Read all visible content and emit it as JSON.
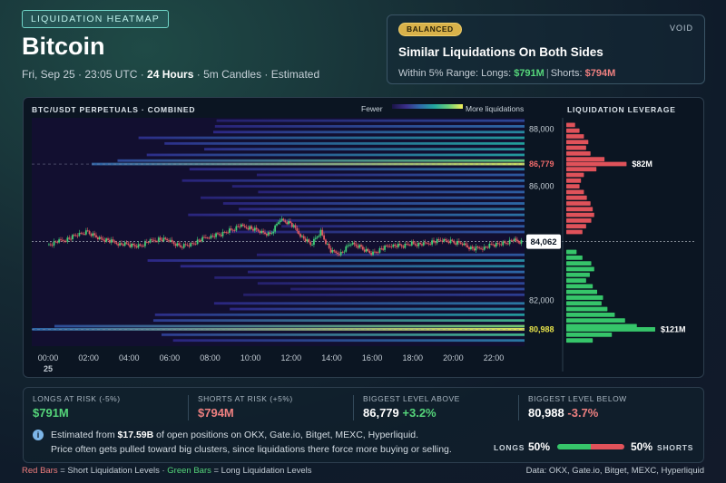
{
  "header": {
    "tag": "LIQUIDATION HEATMAP",
    "title": "Bitcoin",
    "subtitle_pre": "Fri, Sep 25 · 23:05 UTC · ",
    "subtitle_bold": "24 Hours",
    "subtitle_post": " · 5m Candles · Estimated"
  },
  "summary": {
    "badge": "BALANCED",
    "logo": "VOID",
    "title": "Similar Liquidations On Both Sides",
    "range_label": "Within 5% Range: Longs: ",
    "longs": "$791M",
    "divider": "|",
    "shorts_label": "Shorts: ",
    "shorts": "$794M"
  },
  "chart_panel": {
    "heatmap_label": "BTC/USDT PERPETUALS · COMBINED",
    "legend_fewer": "Fewer",
    "legend_more": "More liquidations",
    "leverage_label": "LIQUIDATION LEVERAGE",
    "current_price": "84,062"
  },
  "chart_data": [
    {
      "type": "heatmap",
      "title": "BTC/USDT PERPETUALS · COMBINED",
      "x_ticks": [
        "00:00",
        "02:00",
        "04:00",
        "06:00",
        "08:00",
        "10:00",
        "12:00",
        "14:00",
        "16:00",
        "18:00",
        "20:00",
        "22:00"
      ],
      "x_sublabel": "25",
      "y_ticks": [
        88000,
        86000,
        82000
      ],
      "y_highlight_above": "86,779",
      "y_highlight_below": "80,988",
      "ylim": [
        80400,
        88400
      ],
      "current_price": 84062,
      "legend": [
        "Fewer",
        "More liquidations"
      ],
      "price_path": [
        [
          0,
          83950
        ],
        [
          0.5,
          84050
        ],
        [
          1,
          84150
        ],
        [
          1.5,
          84300
        ],
        [
          2,
          84400
        ],
        [
          2.5,
          84200
        ],
        [
          3,
          84100
        ],
        [
          3.5,
          84000
        ],
        [
          4,
          83950
        ],
        [
          4.5,
          83900
        ],
        [
          5,
          84050
        ],
        [
          5.5,
          84150
        ],
        [
          6,
          84100
        ],
        [
          6.5,
          83900
        ],
        [
          7,
          83950
        ],
        [
          7.5,
          84100
        ],
        [
          8,
          84250
        ],
        [
          8.5,
          84300
        ],
        [
          9,
          84450
        ],
        [
          9.5,
          84600
        ],
        [
          10,
          84550
        ],
        [
          10.5,
          84400
        ],
        [
          11,
          84300
        ],
        [
          11.5,
          84850
        ],
        [
          12,
          84700
        ],
        [
          12.5,
          84300
        ],
        [
          13,
          83950
        ],
        [
          13.5,
          84400
        ],
        [
          14,
          83700
        ],
        [
          14.5,
          83650
        ],
        [
          15,
          84000
        ],
        [
          15.5,
          83850
        ],
        [
          16,
          83650
        ],
        [
          16.5,
          83800
        ],
        [
          17,
          83950
        ],
        [
          17.5,
          83900
        ],
        [
          18,
          84000
        ],
        [
          18.5,
          83950
        ],
        [
          19,
          84050
        ],
        [
          19.5,
          84100
        ],
        [
          20,
          84050
        ],
        [
          20.5,
          84000
        ],
        [
          21,
          83800
        ],
        [
          21.5,
          83850
        ],
        [
          22,
          83950
        ],
        [
          22.5,
          84000
        ],
        [
          23,
          84100
        ],
        [
          23.4,
          84062
        ]
      ],
      "bands": [
        {
          "price": 88300,
          "intensity": 0.35
        },
        {
          "price": 88100,
          "intensity": 0.45
        },
        {
          "price": 87900,
          "intensity": 0.55
        },
        {
          "price": 87700,
          "intensity": 0.6
        },
        {
          "price": 87500,
          "intensity": 0.62
        },
        {
          "price": 87300,
          "intensity": 0.6
        },
        {
          "price": 87100,
          "intensity": 0.6
        },
        {
          "price": 86900,
          "intensity": 0.78
        },
        {
          "price": 86780,
          "intensity": 0.95
        },
        {
          "price": 86600,
          "intensity": 0.5
        },
        {
          "price": 86400,
          "intensity": 0.4
        },
        {
          "price": 86200,
          "intensity": 0.45
        },
        {
          "price": 86000,
          "intensity": 0.4
        },
        {
          "price": 85800,
          "intensity": 0.42
        },
        {
          "price": 85600,
          "intensity": 0.42
        },
        {
          "price": 85400,
          "intensity": 0.45
        },
        {
          "price": 85200,
          "intensity": 0.5
        },
        {
          "price": 85000,
          "intensity": 0.48
        },
        {
          "price": 84800,
          "intensity": 0.4
        },
        {
          "price": 84600,
          "intensity": 0.4
        },
        {
          "price": 84400,
          "intensity": 0.38
        },
        {
          "price": 83600,
          "intensity": 0.4
        },
        {
          "price": 83400,
          "intensity": 0.55
        },
        {
          "price": 83200,
          "intensity": 0.55
        },
        {
          "price": 83000,
          "intensity": 0.45
        },
        {
          "price": 82800,
          "intensity": 0.38
        },
        {
          "price": 82600,
          "intensity": 0.35
        },
        {
          "price": 82400,
          "intensity": 0.35
        },
        {
          "price": 82200,
          "intensity": 0.32
        },
        {
          "price": 81900,
          "intensity": 0.5
        },
        {
          "price": 81700,
          "intensity": 0.55
        },
        {
          "price": 81500,
          "intensity": 0.6
        },
        {
          "price": 81300,
          "intensity": 0.7
        },
        {
          "price": 81100,
          "intensity": 0.82
        },
        {
          "price": 80990,
          "intensity": 0.98
        },
        {
          "price": 80800,
          "intensity": 0.7
        },
        {
          "price": 80600,
          "intensity": 0.5
        }
      ]
    },
    {
      "type": "bar",
      "title": "LIQUIDATION LEVERAGE",
      "orientation": "horizontal",
      "series": [
        {
          "name": "Short Liquidation Levels",
          "color": "#e0525a",
          "x": [
            88150,
            87950,
            87750,
            87550,
            87350,
            87150,
            86950,
            86780,
            86600,
            86400,
            86200,
            86000,
            85800,
            85600,
            85400,
            85200,
            85000,
            84800,
            84600,
            84400
          ],
          "values": [
            12,
            18,
            24,
            30,
            27,
            33,
            52,
            82,
            41,
            24,
            20,
            18,
            24,
            28,
            33,
            36,
            38,
            34,
            27,
            22
          ]
        },
        {
          "name": "Long Liquidation Levels",
          "color": "#36c56a",
          "x": [
            83700,
            83500,
            83300,
            83100,
            82900,
            82700,
            82500,
            82300,
            82100,
            81900,
            81700,
            81500,
            81300,
            81100,
            80990,
            80800,
            80600
          ],
          "values": [
            14,
            22,
            34,
            38,
            32,
            27,
            36,
            42,
            50,
            48,
            56,
            66,
            80,
            96,
            121,
            62,
            36
          ]
        }
      ],
      "labels": [
        {
          "price": 86779,
          "text": "$82M"
        },
        {
          "price": 80988,
          "text": "$121M"
        }
      ]
    }
  ],
  "stats": {
    "longs_at_risk_label": "LONGS AT RISK (-5%)",
    "longs_at_risk_value": "$791M",
    "shorts_at_risk_label": "SHORTS AT RISK (+5%)",
    "shorts_at_risk_value": "$794M",
    "biggest_above_label": "BIGGEST LEVEL ABOVE",
    "biggest_above_value": "86,779",
    "biggest_above_pct": "+3.2%",
    "biggest_below_label": "BIGGEST LEVEL BELOW",
    "biggest_below_value": "80,988",
    "biggest_below_pct": "-3.7%",
    "info_icon": "i",
    "info_pre": "Estimated from ",
    "info_amount": "$17.59B",
    "info_post": " of open positions on OKX, Gate.io, Bitget, MEXC, Hyperliquid.",
    "info_line2": "Price often gets pulled toward big clusters, since liquidations there force more buying or selling.",
    "longs_label": "LONGS",
    "longs_pct": "50%",
    "shorts_pct": "50%",
    "shorts_label": "SHORTS",
    "long_ratio": 0.5
  },
  "footer": {
    "red_label": "Red Bars",
    "red_text": " = Short Liquidation Levels · ",
    "green_label": "Green Bars",
    "green_text": " = Long Liquidation Levels",
    "source": "Data: OKX, Gate.io, Bitget, MEXC, Hyperliquid"
  },
  "colors": {
    "long": "#36c56a",
    "short": "#e0525a",
    "accent": "#6fd3c6",
    "badge": "#d9b24a"
  }
}
